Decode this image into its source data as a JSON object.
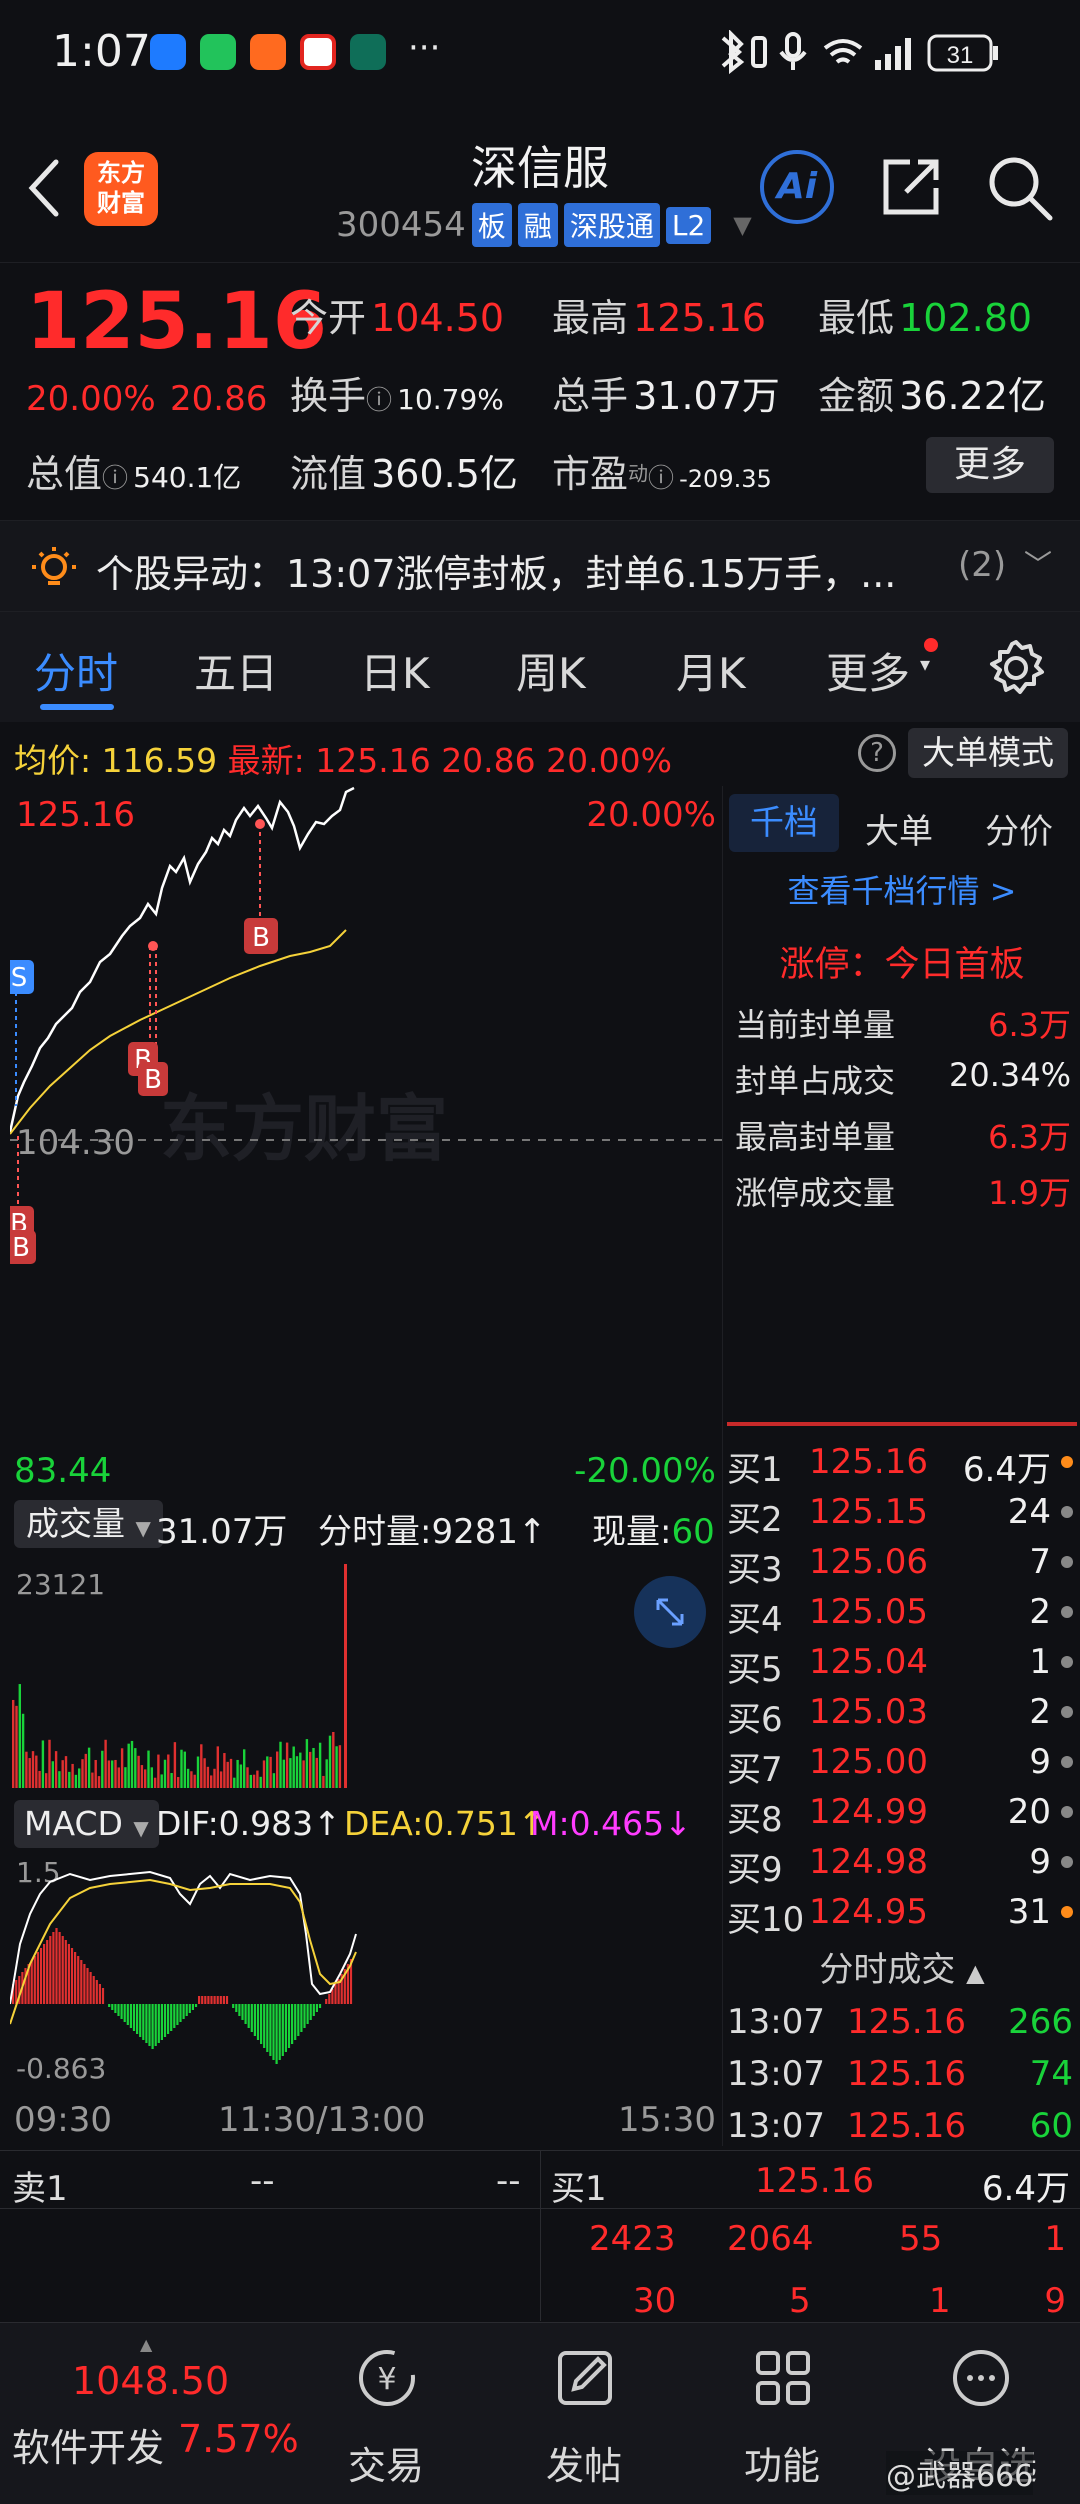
{
  "status_bar": {
    "time": "1:07",
    "more": "···",
    "battery": "31"
  },
  "header": {
    "back_icon": "chevron-left-icon",
    "logo_text_1": "东方",
    "logo_text_2": "财富",
    "title": "深信服",
    "code": "300454",
    "tags": [
      "板",
      "融",
      "深股通",
      "L2"
    ],
    "ai_label": "Ai"
  },
  "quote": {
    "price": "125.16",
    "change_pct": "20.00%",
    "change_amt": "20.86",
    "open_label": "今开",
    "open": "104.50",
    "high_label": "最高",
    "high": "125.16",
    "low_label": "最低",
    "low": "102.80",
    "turnover_label": "换手",
    "turnover": "10.79%",
    "volume_label": "总手",
    "volume": "31.07万",
    "amount_label": "金额",
    "amount": "36.22亿",
    "mktcap_label": "总值",
    "mktcap": "540.1亿",
    "float_label": "流值",
    "float": "360.5亿",
    "pe_label": "市盈",
    "pe_sup": "动",
    "pe": "-209.35",
    "more_button": "更多"
  },
  "alert": {
    "text": "个股异动：13:07涨停封板，封单6.15万手，...",
    "count": "(2)"
  },
  "tabs": [
    "分时",
    "五日",
    "日K",
    "周K",
    "月K",
    "更多"
  ],
  "chart_header": {
    "avg_label": "均价:",
    "avg": "116.59",
    "latest_label": "最新:",
    "latest": "125.16",
    "chg": "20.86",
    "pct": "20.00%",
    "mode_button": "大单模式"
  },
  "chart_labels": {
    "top_price": "125.16",
    "top_pct": "20.00%",
    "mid_price": "104.30",
    "bottom_price": "83.44",
    "bottom_pct": "-20.00%",
    "watermark": "东方财富",
    "marker_s": "S",
    "marker_b": "B"
  },
  "volume_bar": {
    "label": "成交量",
    "total": "31.07万",
    "tick_label": "分时量:9281↑",
    "now_label": "现量:",
    "now": "60",
    "max": "23121"
  },
  "macd": {
    "label": "MACD",
    "dif": "DIF:0.983↑",
    "dea": "DEA:0.751↑",
    "m": "M:0.465↓",
    "top": "1.5",
    "bottom": "-0.863"
  },
  "time_axis": [
    "09:30",
    "11:30/13:00",
    "15:30"
  ],
  "right_panel": {
    "tabs": [
      "千档",
      "大单",
      "分价"
    ],
    "link": "查看千档行情 >",
    "limit_title": "涨停：今日首板",
    "stats": [
      {
        "label": "当前封单量",
        "value": "6.3万"
      },
      {
        "label": "封单占成交",
        "value": "20.34%"
      },
      {
        "label": "最高封单量",
        "value": "6.3万"
      },
      {
        "label": "涨停成交量",
        "value": "1.9万"
      }
    ],
    "bids": [
      {
        "label": "买1",
        "price": "125.16",
        "qty": "6.4万"
      },
      {
        "label": "买2",
        "price": "125.15",
        "qty": "24"
      },
      {
        "label": "买3",
        "price": "125.06",
        "qty": "7"
      },
      {
        "label": "买4",
        "price": "125.05",
        "qty": "2"
      },
      {
        "label": "买5",
        "price": "125.04",
        "qty": "1"
      },
      {
        "label": "买6",
        "price": "125.03",
        "qty": "2"
      },
      {
        "label": "买7",
        "price": "125.00",
        "qty": "9"
      },
      {
        "label": "买8",
        "price": "124.99",
        "qty": "20"
      },
      {
        "label": "买9",
        "price": "124.98",
        "qty": "9"
      },
      {
        "label": "买10",
        "price": "124.95",
        "qty": "31"
      }
    ],
    "trades_title": "分时成交",
    "trades": [
      {
        "time": "13:07",
        "price": "125.16",
        "qty": "266"
      },
      {
        "time": "13:07",
        "price": "125.16",
        "qty": "74"
      },
      {
        "time": "13:07",
        "price": "125.16",
        "qty": "60"
      }
    ]
  },
  "bottom_table": {
    "sell_label": "卖1",
    "sell_price": "--",
    "sell_qty": "--",
    "buy_label": "买1",
    "buy_price": "125.16",
    "buy_qty": "6.4万",
    "row2": [
      "2423",
      "2064",
      "55",
      "1"
    ],
    "row3": [
      "30",
      "5",
      "1",
      "9"
    ]
  },
  "navbar": {
    "index_value": "1048.50",
    "index_name": "软件开发",
    "index_pct": "7.57%",
    "items": [
      "交易",
      "发帖",
      "功能",
      "设自选"
    ],
    "watermark": "@武器666"
  },
  "colors": {
    "up": "#ff2b2b",
    "down": "#19d33a",
    "accent": "#2f6fd8",
    "avg_line": "#f5d23a"
  }
}
